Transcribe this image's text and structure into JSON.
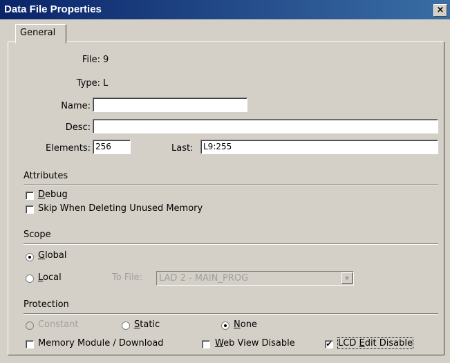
{
  "window": {
    "title": "Data File Properties",
    "close": "×"
  },
  "tab": {
    "label": "General"
  },
  "fields": {
    "file_label": "File:",
    "file_value": "9",
    "type_label": "Type:",
    "type_value": "L",
    "name_label": "Name:",
    "name_value": "",
    "desc_label": "Desc:",
    "desc_value": "",
    "elements_label": "Elements:",
    "elements_value": "256",
    "last_label": "Last:",
    "last_value": "L9:255"
  },
  "attributes": {
    "heading": "Attributes",
    "debug_label": "Debug",
    "debug_checked": false,
    "skip_label": "Skip When Deleting Unused Memory",
    "skip_checked": false
  },
  "scope": {
    "heading": "Scope",
    "global_label": "Global",
    "global_selected": true,
    "local_label": "Local",
    "local_selected": false,
    "tofile_label": "To File:",
    "tofile_value": "LAD 2 - MAIN_PROG",
    "dropdown_icon": "▼"
  },
  "protection": {
    "heading": "Protection",
    "constant_label": "Constant",
    "constant_enabled": false,
    "static_label": "Static",
    "none_label": "None",
    "none_selected": true,
    "memory_label": "Memory Module / Download",
    "memory_checked": false,
    "webview_label": "Web View Disable",
    "webview_checked": false,
    "lcd_label": "LCD Edit Disable",
    "lcd_checked": true,
    "check_mark": "✔"
  }
}
